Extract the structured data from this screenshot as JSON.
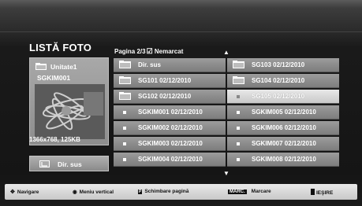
{
  "header": {
    "title": "LISTĂ FOTO",
    "page_info": "Pagina 2/3",
    "checkbox_symbol": "☑",
    "marked_status": "Nemarcat"
  },
  "preview": {
    "folder_name": "Unitate1",
    "file_name": "SGKIM001",
    "resolution": "1366x768, 125KB",
    "dir_button": "Dir. sus"
  },
  "grid": {
    "left": [
      {
        "label": "Dir. sus",
        "type": "folder",
        "selected": false
      },
      {
        "label": "SG101 02/12/2010",
        "type": "folder",
        "selected": false
      },
      {
        "label": "SG102 02/12/2010",
        "type": "folder",
        "selected": false
      },
      {
        "label": "SGKIM001 02/12/2010",
        "type": "file",
        "selected": false
      },
      {
        "label": "SGKIM002 02/12/2010",
        "type": "file",
        "selected": false
      },
      {
        "label": "SGKIM003 02/12/2010",
        "type": "file",
        "selected": false
      },
      {
        "label": "SGKIM004 02/12/2010",
        "type": "file",
        "selected": false
      }
    ],
    "right": [
      {
        "label": "SG103 02/12/2010",
        "type": "folder",
        "selected": false
      },
      {
        "label": "SG104 02/12/2010",
        "type": "folder",
        "selected": false
      },
      {
        "label": "SG105 02/12/2010",
        "type": "file",
        "selected": true
      },
      {
        "label": "SGKIM005 02/12/2010",
        "type": "file",
        "selected": false
      },
      {
        "label": "SGKIM006 02/12/2010",
        "type": "file",
        "selected": false
      },
      {
        "label": "SGKIM007 02/12/2010",
        "type": "file",
        "selected": false
      },
      {
        "label": "SGKIM008 02/12/2010",
        "type": "file",
        "selected": false
      }
    ]
  },
  "bottom_bar": {
    "navigate": "Navigare",
    "vertical_menu": "Meniu vertical",
    "page_change": "Schimbare pagină",
    "marc_key": "MARC.",
    "mark": "Marcare",
    "exit": "IEŞIRE"
  }
}
